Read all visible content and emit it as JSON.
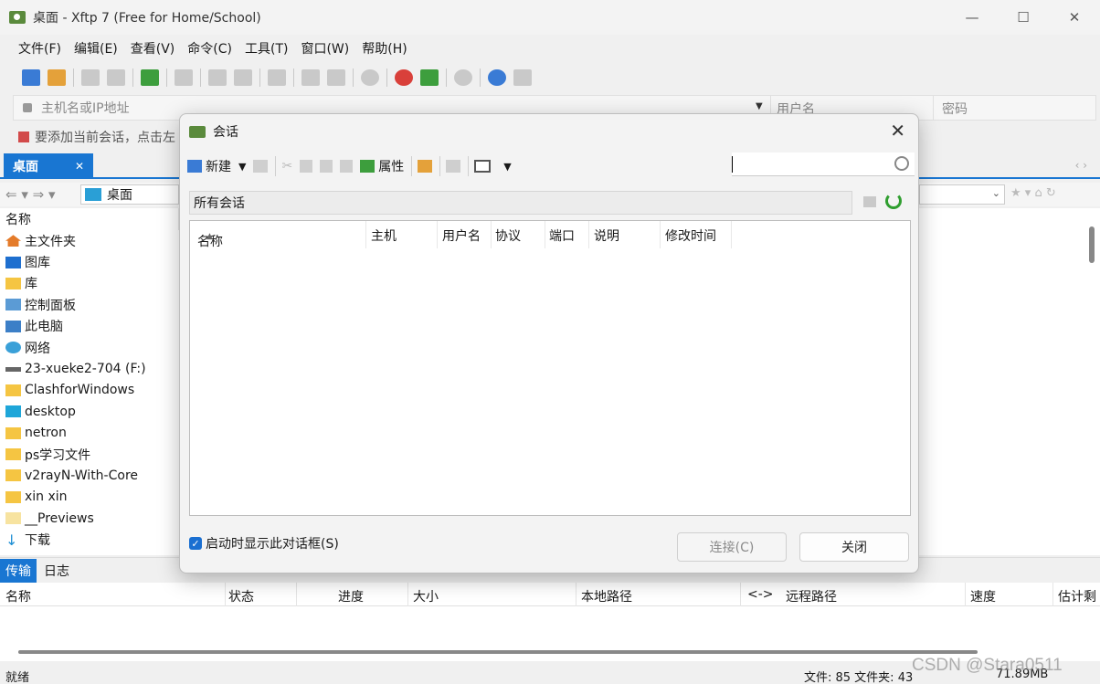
{
  "window": {
    "title": "桌面 - Xftp 7 (Free for Home/School)",
    "minimize": "—",
    "maximize": "☐",
    "close": "✕"
  },
  "menu": [
    "文件(F)",
    "编辑(E)",
    "查看(V)",
    "命令(C)",
    "工具(T)",
    "窗口(W)",
    "帮助(H)"
  ],
  "address": {
    "host_placeholder": "主机名或IP地址",
    "username_placeholder": "用户名",
    "password_placeholder": "密码"
  },
  "hint": "要添加当前会话，点击左",
  "left_pane": {
    "tab_label": "桌面",
    "path": "桌面",
    "column_name": "名称",
    "items": [
      {
        "icon": "home-icon",
        "name": "主文件夹"
      },
      {
        "icon": "gallery-icon",
        "name": "图库"
      },
      {
        "icon": "folder-icon",
        "name": "库"
      },
      {
        "icon": "control-panel-icon",
        "name": "控制面板"
      },
      {
        "icon": "computer-icon",
        "name": "此电脑"
      },
      {
        "icon": "network-icon",
        "name": "网络"
      },
      {
        "icon": "drive-icon",
        "name": "23-xueke2-704 (F:)"
      },
      {
        "icon": "folder-icon",
        "name": "ClashforWindows"
      },
      {
        "icon": "desktop-folder-icon",
        "name": "desktop"
      },
      {
        "icon": "folder-icon",
        "name": "netron"
      },
      {
        "icon": "folder-icon",
        "name": "ps学习文件"
      },
      {
        "icon": "folder-icon",
        "name": "v2rayN-With-Core"
      },
      {
        "icon": "folder-icon",
        "name": "xin xin"
      },
      {
        "icon": "folder-pale-icon",
        "name": "__Previews"
      },
      {
        "icon": "download-icon",
        "name": "下载"
      }
    ]
  },
  "transfer": {
    "tabs": [
      "传输",
      "日志"
    ],
    "columns": [
      "名称",
      "状态",
      "进度",
      "大小",
      "本地路径",
      "<->",
      "远程路径",
      "速度",
      "估计剩"
    ]
  },
  "status": {
    "ready": "就绪",
    "counts": "文件: 85  文件夹: 43",
    "size": "71.89MB",
    "watermark": "CSDN @Stara0511"
  },
  "dialog": {
    "title": "会话",
    "new_label": "新建",
    "properties_label": "属性",
    "folder_label": "所有会话",
    "columns": [
      "名称",
      "主机",
      "用户名",
      "协议",
      "端口",
      "说明",
      "修改时间"
    ],
    "sort_indicator": "▲",
    "checkbox_label": "启动时显示此对话框(S)",
    "checkbox_checked": true,
    "connect_button": "连接(C)",
    "close_button": "关闭",
    "close_x": "✕"
  }
}
